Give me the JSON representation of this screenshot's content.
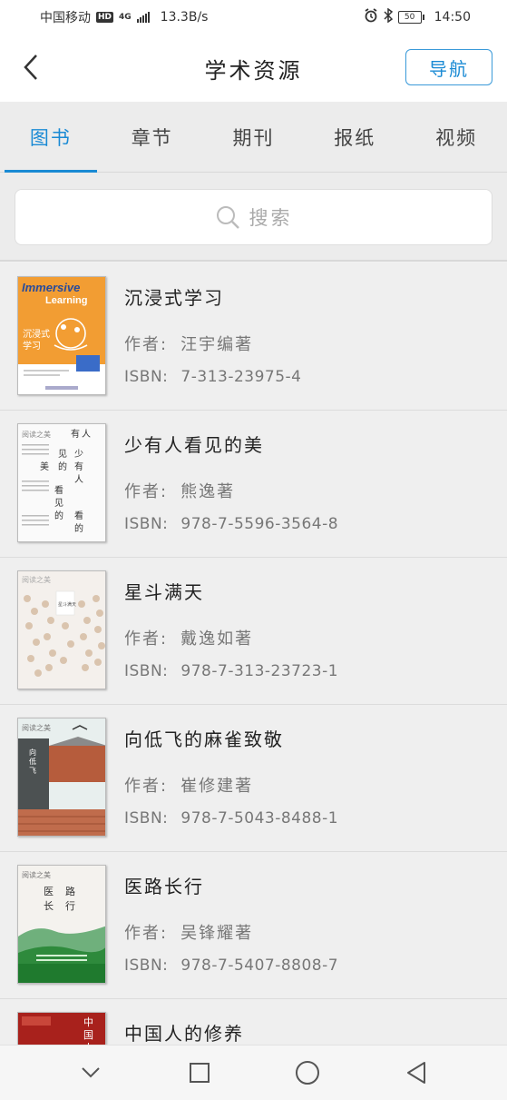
{
  "status_bar": {
    "carrier": "中国移动",
    "hd": "HD",
    "network": "4G",
    "speed": "13.3B/s",
    "battery": "50",
    "time": "14:50"
  },
  "header": {
    "title": "学术资源",
    "nav_button": "导航"
  },
  "tabs": [
    {
      "label": "图书",
      "active": true
    },
    {
      "label": "章节",
      "active": false
    },
    {
      "label": "期刊",
      "active": false
    },
    {
      "label": "报纸",
      "active": false
    },
    {
      "label": "视频",
      "active": false
    }
  ],
  "search": {
    "placeholder": "搜索"
  },
  "labels": {
    "author": "作者:",
    "isbn": "ISBN:"
  },
  "books": [
    {
      "title": "沉浸式学习",
      "author": "汪宇编著",
      "isbn": "7-313-23975-4",
      "cover_text": "Immersive Learning",
      "cover_cn": "沉浸式学习"
    },
    {
      "title": "少有人看见的美",
      "author": "熊逸著",
      "isbn": "978-7-5596-3564-8",
      "cover_text": "阅读之美",
      "cover_cn": "少有人看见的美"
    },
    {
      "title": "星斗满天",
      "author": "戴逸如著",
      "isbn": "978-7-313-23723-1",
      "cover_text": "阅读之美",
      "cover_cn": "星斗满天"
    },
    {
      "title": "向低飞的麻雀致敬",
      "author": "崔修建著",
      "isbn": "978-7-5043-8488-1",
      "cover_text": "阅读之美",
      "cover_cn": "向低飞的麻雀致敬"
    },
    {
      "title": "医路长行",
      "author": "吴锋耀著",
      "isbn": "978-7-5407-8808-7",
      "cover_text": "阅读之美",
      "cover_cn": "医路长行"
    },
    {
      "title": "中国人的修养",
      "author": "",
      "isbn": "",
      "cover_text": "",
      "cover_cn": "中国人"
    }
  ]
}
